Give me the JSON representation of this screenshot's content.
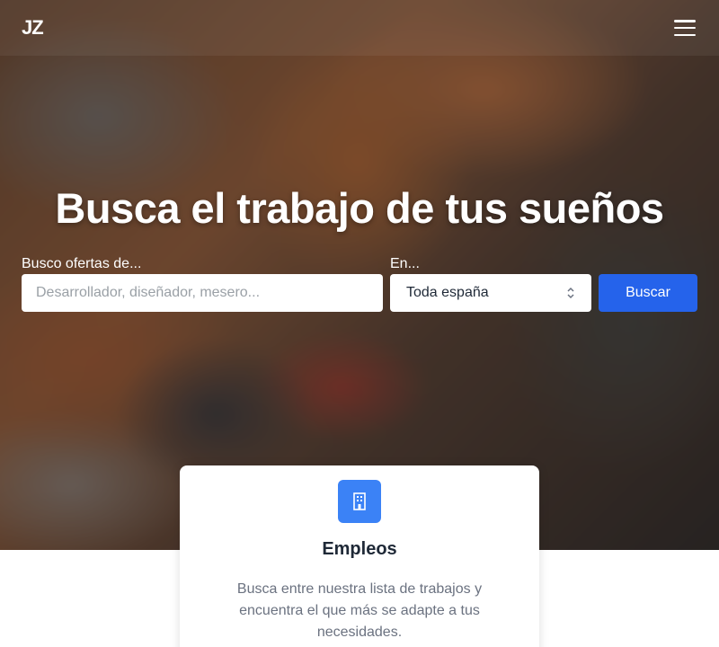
{
  "header": {
    "logo": "JZ"
  },
  "hero": {
    "title": "Busca el trabajo de tus sueños"
  },
  "search": {
    "what_label": "Busco ofertas de...",
    "what_placeholder": "Desarrollador, diseñador, mesero...",
    "where_label": "En...",
    "where_value": "Toda españa",
    "button_label": "Buscar"
  },
  "card": {
    "icon": "building-icon",
    "title": "Empleos",
    "text": "Busca entre nuestra lista de trabajos y encuentra el que más se adapte a tus necesidades."
  },
  "colors": {
    "accent": "#2563eb",
    "icon_bg": "#3b82f6"
  }
}
